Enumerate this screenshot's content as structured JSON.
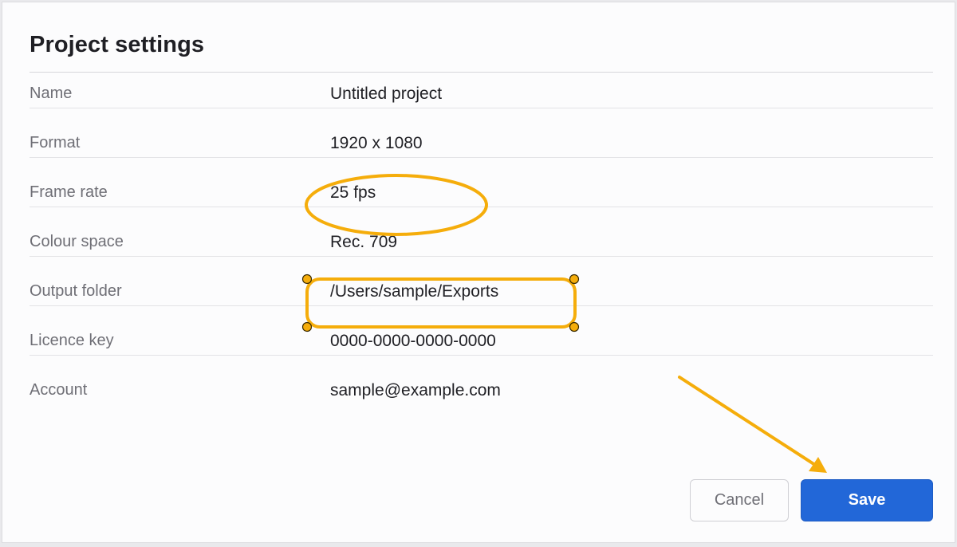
{
  "dialog": {
    "title": "Project settings",
    "fields": [
      {
        "label": "Name",
        "value": "Untitled project"
      },
      {
        "label": "Format",
        "value": "1920 x 1080"
      },
      {
        "label": "Frame rate",
        "value": "25 fps"
      },
      {
        "label": "Colour space",
        "value": "Rec. 709"
      },
      {
        "label": "Output folder",
        "value": "/Users/sample/Exports"
      },
      {
        "label": "Licence key",
        "value": "0000-0000-0000-0000"
      },
      {
        "label": "Account",
        "value": "sample@example.com"
      }
    ],
    "buttons": {
      "cancel_label": "Cancel",
      "save_label": "Save"
    }
  },
  "colors": {
    "accent": "#2267d8",
    "annotation": "#f5ad0b"
  }
}
